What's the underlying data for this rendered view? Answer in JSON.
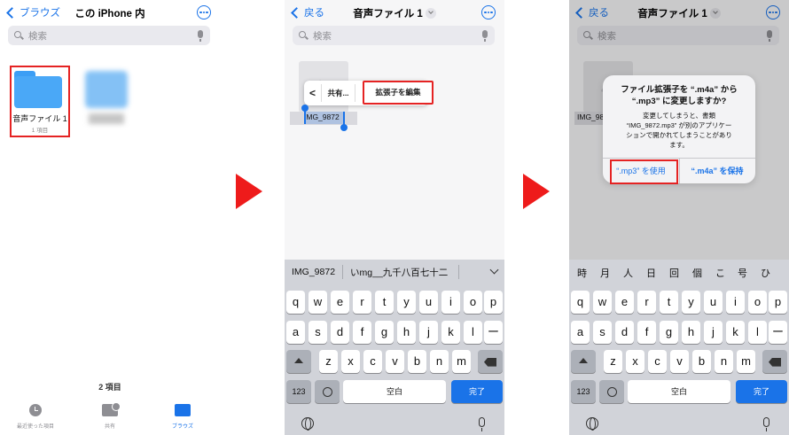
{
  "panel1": {
    "back_label": "ブラウズ",
    "title": "この iPhone 内",
    "search_placeholder": "検索",
    "folder_name": "音声ファイル 1",
    "folder_count": "1 項目",
    "item_count": "2 項目",
    "tabs": [
      {
        "label": "最近使った項目",
        "icon": "clock-icon"
      },
      {
        "label": "共有",
        "icon": "shared-folder-icon"
      },
      {
        "label": "ブラウズ",
        "icon": "folder-icon"
      }
    ]
  },
  "panel2": {
    "back_label": "戻る",
    "title": "音声ファイル 1",
    "search_placeholder": "検索",
    "menu": {
      "prev": "<",
      "share": "共有...",
      "edit_ext": "拡張子を編集"
    },
    "filename": "IMG_9872",
    "suggestions": [
      "IMG_9872",
      "いmg__九千八百七十二"
    ]
  },
  "panel3": {
    "back_label": "戻る",
    "title": "音声ファイル 1",
    "search_placeholder": "検索",
    "filename": "IMG_9872",
    "alert": {
      "title": "ファイル拡張子を “.m4a” から “.mp3” に変更しますか?",
      "message": "変更してしまうと、書類 “IMG_9872.mp3” が別のアプリケーションで開かれてしまうことがあります。",
      "use_btn": "“.mp3” を使用",
      "keep_btn": "“.m4a” を保持"
    },
    "kana": [
      "時",
      "月",
      "人",
      "日",
      "回",
      "個",
      "こ",
      "号",
      "ひ"
    ]
  },
  "keyboard": {
    "row1": [
      "q",
      "w",
      "e",
      "r",
      "t",
      "y",
      "u",
      "i",
      "o",
      "p"
    ],
    "row2": [
      "a",
      "s",
      "d",
      "f",
      "g",
      "h",
      "j",
      "k",
      "l",
      "ー"
    ],
    "row3": [
      "z",
      "x",
      "c",
      "v",
      "b",
      "n",
      "m"
    ],
    "num_key": "123",
    "space_key": "空白",
    "done_key": "完了"
  },
  "colors": {
    "accent": "#1a73e8",
    "highlight": "#e52323",
    "arrow": "#ee1b1b"
  }
}
